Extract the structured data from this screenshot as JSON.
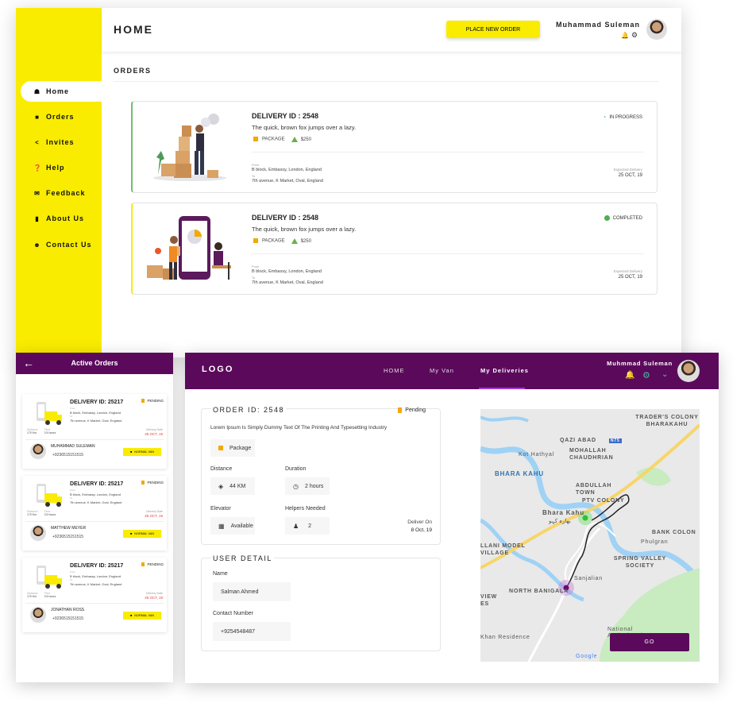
{
  "dashboard": {
    "title": "HOME",
    "place_order_label": "PLACE NEW ORDER",
    "user_name": "Muhammad Suleman",
    "orders_heading": "ORDERS",
    "sidebar": [
      {
        "label": "Home",
        "icon": "home-icon"
      },
      {
        "label": "Orders",
        "icon": "truck-icon"
      },
      {
        "label": "Invites",
        "icon": "share-icon"
      },
      {
        "label": "Help",
        "icon": "help-icon"
      },
      {
        "label": "Feedback",
        "icon": "mail-icon"
      },
      {
        "label": "About Us",
        "icon": "info-icon"
      },
      {
        "label": "Contact Us",
        "icon": "contact-icon"
      }
    ],
    "orders": [
      {
        "delivery_id": "DELIVERY ID : 2548",
        "description": "The quick, brown fox jumps over a lazy.",
        "package": "PACKAGE",
        "price": "$250",
        "from_label": "From",
        "from": "B block, Embassy, London, England",
        "to_label": "To",
        "to": "7th avenue, K Market, Oval, England",
        "expected_label": "Expected Delivery",
        "expected": "25 OCT, 19",
        "status": "IN PROGRESS"
      },
      {
        "delivery_id": "DELIVERY ID : 2548",
        "description": "The quick, brown fox jumps over a lazy.",
        "package": "PACKAGE",
        "price": "$250",
        "from_label": "From",
        "from": "B block, Embassy, London, England",
        "to_label": "To",
        "to": "7th avenue, K Market, Oval, England",
        "expected_label": "Expected Delivery",
        "expected": "25 OCT, 19",
        "status": "COMPLETED"
      }
    ]
  },
  "active_orders": {
    "title": "Active Orders",
    "items": [
      {
        "title": "DELIVERY ID: 25217",
        "status": "PENDING",
        "from_label": "From",
        "from": "B block, Embassy, London, England",
        "to_label": "To",
        "to": "7th avenue, K Market, Oval, England",
        "distance_label": "Distance",
        "distance": "170 Km",
        "time_label": "Time",
        "time": "3.5 hours",
        "deliver_label": "Delivery Date",
        "deliver": "25 OCT, 19",
        "person": "MUHAMMAD SULEMAN",
        "phone": "+9236515151515",
        "van": "NORMAL VAN"
      },
      {
        "title": "DELIVERY ID: 25217",
        "status": "PENDING",
        "from_label": "From",
        "from": "B block, Embassy, London, England",
        "to_label": "To",
        "to": "7th avenue, K Market, Oval, England",
        "distance_label": "Distance",
        "distance": "170 Km",
        "time_label": "Time",
        "time": "3.5 hours",
        "deliver_label": "Delivery Date",
        "deliver": "25 OCT, 19",
        "person": "MATTHEW MEYER",
        "phone": "+9236515151515",
        "van": "NORMAL VAN"
      },
      {
        "title": "DELIVERY ID: 25217",
        "status": "PENDING",
        "from_label": "From",
        "from": "B block, Embassy, London, England",
        "to_label": "To",
        "to": "7th avenue, K Market, Oval, England",
        "distance_label": "Distance",
        "distance": "170 Km",
        "time_label": "Time",
        "time": "3.5 hours",
        "deliver_label": "Delivery Date",
        "deliver": "25 OCT, 19",
        "person": "JONATHAN ROSS",
        "phone": "+9236515151515",
        "van": "NORMAL VAN"
      }
    ]
  },
  "deliveries": {
    "logo": "LOGO",
    "nav": [
      "HOME",
      "My Van",
      "My Deliveries"
    ],
    "user_name": "Muhmmad Suleman",
    "order_id": "ORDER ID: 2548",
    "status": "Pending",
    "description": "Lorem Ipsum Is Simply Dummy Text Of The Printing And Typesetting Industry",
    "package": "Package",
    "distance_label": "Distance",
    "distance": "44 KM",
    "duration_label": "Duration",
    "duration": "2 hours",
    "elevator_label": "Elevator",
    "elevator": "Available",
    "helpers_label": "Helpers Needed",
    "helpers": "2",
    "deliver_on_label": "Deliver On",
    "deliver_on": "8 Oct, 19",
    "user_detail_heading": "USER DETAIL",
    "name_label": "Name",
    "name": "Salman Ahmed",
    "contact_label": "Contact Number",
    "contact": "+9254548487",
    "go_label": "GO",
    "map": {
      "labels": [
        "TRADER'S COLONY BHARAKAHU",
        "QAZI ABAD",
        "MOHALLAH CHAUDHRIAN",
        "Kot Hathyal",
        "BHARA KAHU",
        "ABDULLAH TOWN",
        "PTV COLONY",
        "Bhara Kahu",
        "بھارہ کہو",
        "BANK COLON",
        "Phulgran",
        "LLANI MODEL VILLAGE",
        "SPRING VALLEY SOCIETY",
        "NORTH BANIGALA",
        "Sanjalian",
        "VIEW ES",
        "Khan Residence",
        "National Agricultural",
        "Google",
        "N75"
      ],
      "colors": {
        "water": "#9fd2f5",
        "green": "#c8ebc0",
        "road": "#f7d56b"
      }
    }
  }
}
